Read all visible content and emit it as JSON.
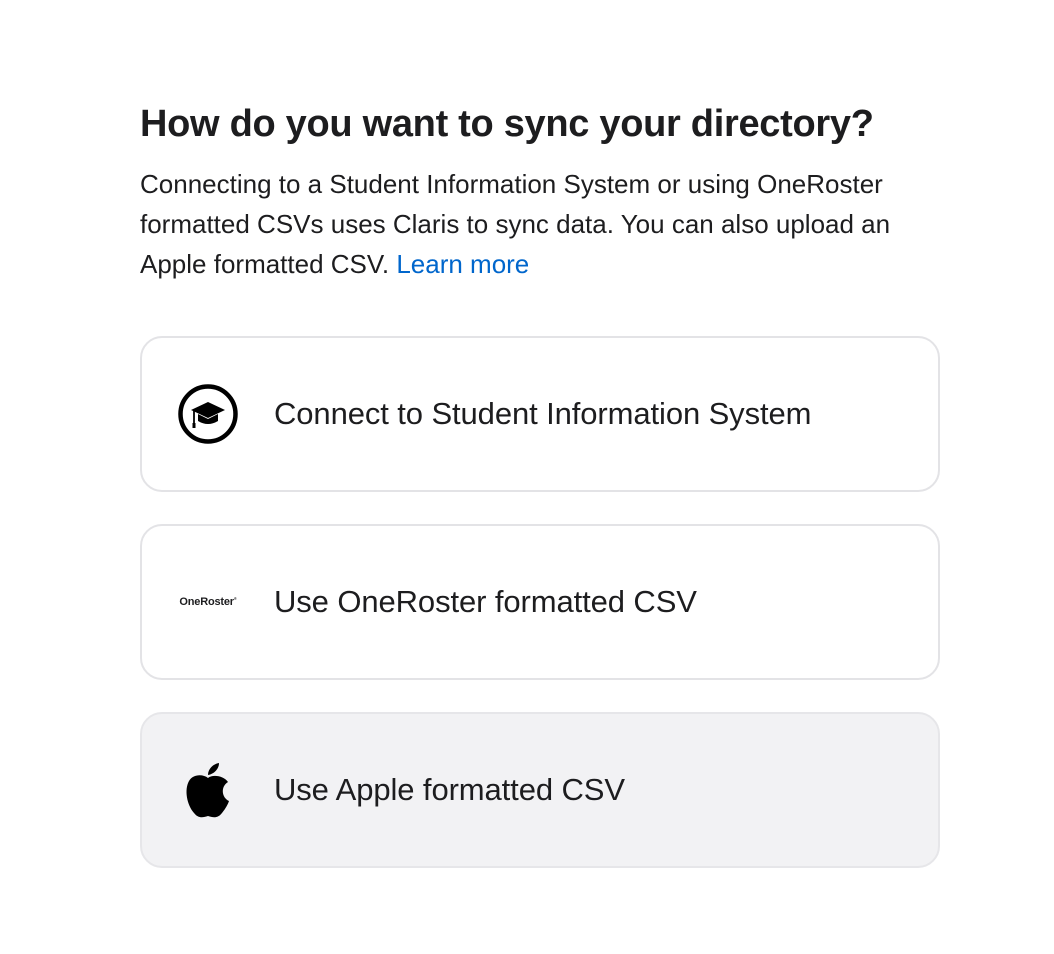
{
  "header": {
    "title": "How do you want to sync your directory?",
    "description": "Connecting to a Student Information System or using OneRoster formatted CSVs uses Claris to sync data. You can also upload an Apple formatted CSV.",
    "learn_more": "Learn more"
  },
  "options": [
    {
      "label": "Connect to Student Information System",
      "icon": "graduation-cap-icon",
      "selected": false
    },
    {
      "label": "Use OneRoster formatted CSV",
      "icon": "oneroster-logo",
      "logo_text": "OneRoster",
      "selected": false
    },
    {
      "label": "Use Apple formatted CSV",
      "icon": "apple-logo-icon",
      "selected": true
    }
  ],
  "colors": {
    "link": "#0066cc",
    "text": "#1d1d1f",
    "card_border": "#e3e3e6",
    "card_selected_bg": "#f2f2f4"
  }
}
